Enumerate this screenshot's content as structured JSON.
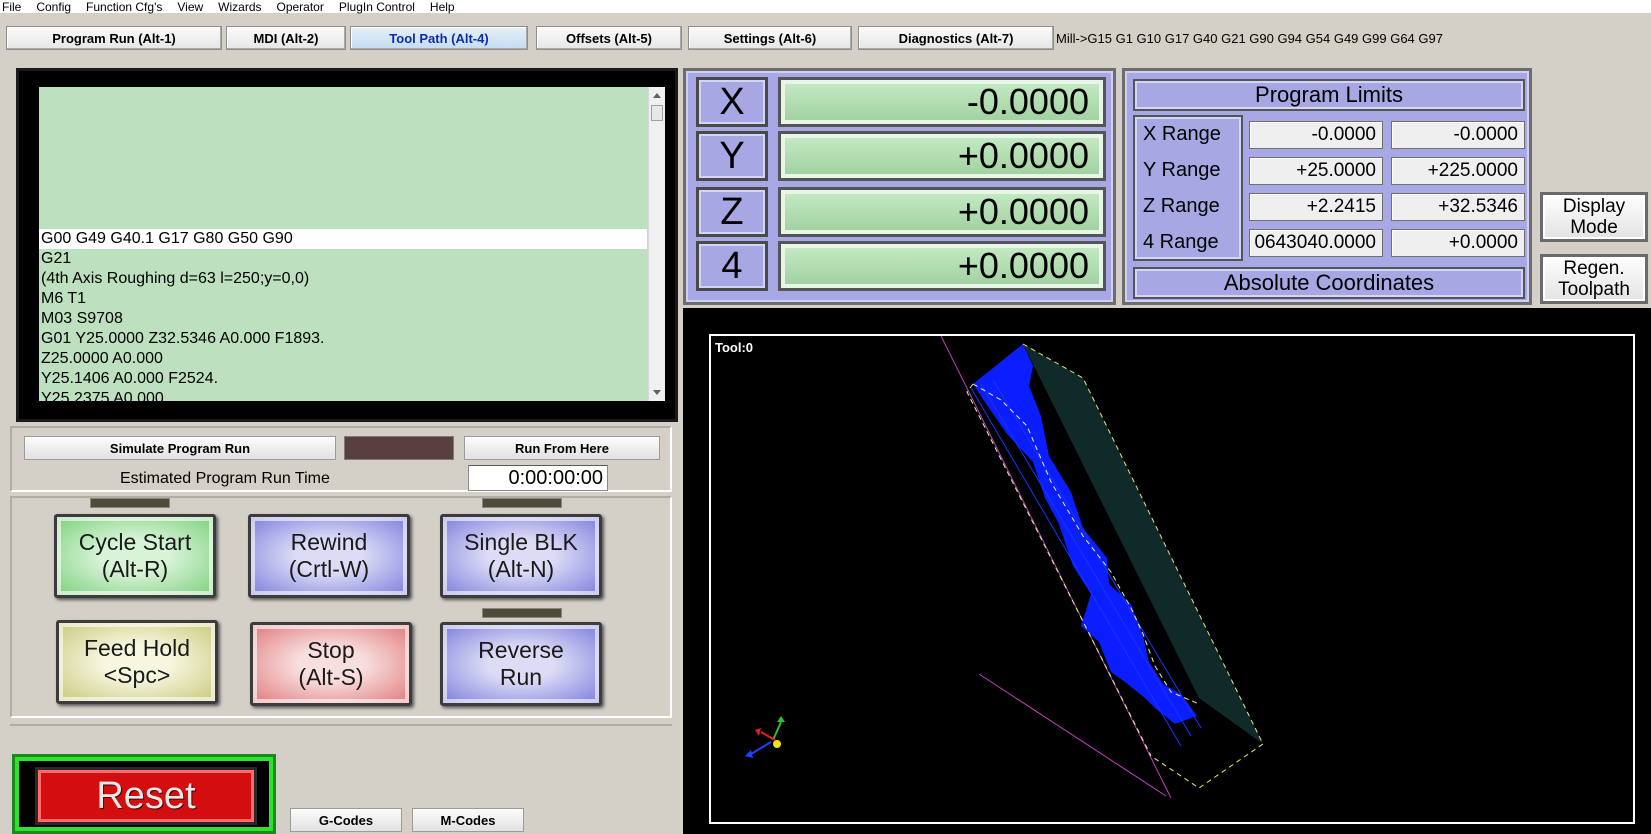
{
  "menu": [
    "File",
    "Config",
    "Function Cfg's",
    "View",
    "Wizards",
    "Operator",
    "PlugIn Control",
    "Help"
  ],
  "tabs": [
    {
      "label": "Program Run (Alt-1)",
      "active": false
    },
    {
      "label": "MDI (Alt-2)",
      "active": false
    },
    {
      "label": "Tool Path (Alt-4)",
      "active": true
    },
    {
      "label": "Offsets (Alt-5)",
      "active": false
    },
    {
      "label": "Settings (Alt-6)",
      "active": false
    },
    {
      "label": "Diagnostics (Alt-7)",
      "active": false
    }
  ],
  "modal_line": "Mill->G15  G1 G10 G17 G40 G21 G90 G94 G54 G49 G99 G64 G97",
  "gcode": {
    "lines": [
      "G00 G49 G40.1 G17 G80 G50 G90",
      "G21",
      "(4th Axis Roughing d=63 l=250;y=0,0)",
      "M6 T1",
      "M03 S9708",
      "G01  Y25.0000 Z32.5346 A0.000 F1893.",
      "Z25.0000 A0.000",
      "Y25.1406 A0.000 F2524.",
      "Y25.2375 A0.000"
    ],
    "current_index": 0
  },
  "simulate": {
    "simulate_label": "Simulate Program Run",
    "run_from_here_label": "Run From Here",
    "estimated_label": "Estimated Program Run Time",
    "estimated_value": "0:00:00:00"
  },
  "controls": {
    "cycle_start": [
      "Cycle Start",
      "(Alt-R)"
    ],
    "rewind": [
      "Rewind",
      "(Crtl-W)"
    ],
    "single_blk": [
      "Single BLK",
      "(Alt-N)"
    ],
    "feed_hold": [
      "Feed Hold",
      "<Spc>"
    ],
    "stop": [
      "Stop",
      "(Alt-S)"
    ],
    "reverse_run": [
      "Reverse",
      "Run"
    ],
    "reset": "Reset",
    "gcodes": "G-Codes",
    "mcodes": "M-Codes"
  },
  "dro": [
    {
      "axis": "X",
      "value": "-0.0000"
    },
    {
      "axis": "Y",
      "value": "+0.0000"
    },
    {
      "axis": "Z",
      "value": "+0.0000"
    },
    {
      "axis": "4",
      "value": "+0.0000"
    }
  ],
  "limits": {
    "title": "Program Limits",
    "rows": [
      {
        "label": "X Range",
        "min": "-0.0000",
        "max": "-0.0000"
      },
      {
        "label": "Y Range",
        "min": "+25.0000",
        "max": "+225.0000"
      },
      {
        "label": "Z Range",
        "min": "+2.2415",
        "max": "+32.5346"
      },
      {
        "label": "4 Range",
        "min": "0643040.0000",
        "max": "+0.0000"
      }
    ],
    "coords_label": "Absolute Coordinates"
  },
  "side_buttons": {
    "display_mode": [
      "Display",
      "Mode"
    ],
    "regen": [
      "Regen.",
      "Toolpath"
    ]
  },
  "toolpath": {
    "tool_label": "Tool:0"
  },
  "colors": {
    "code_bg": "#bde0be",
    "dro_panel": "#a8a8e6",
    "toolpath_blue": "#0a1eff",
    "reset_red": "#d40e0e"
  }
}
